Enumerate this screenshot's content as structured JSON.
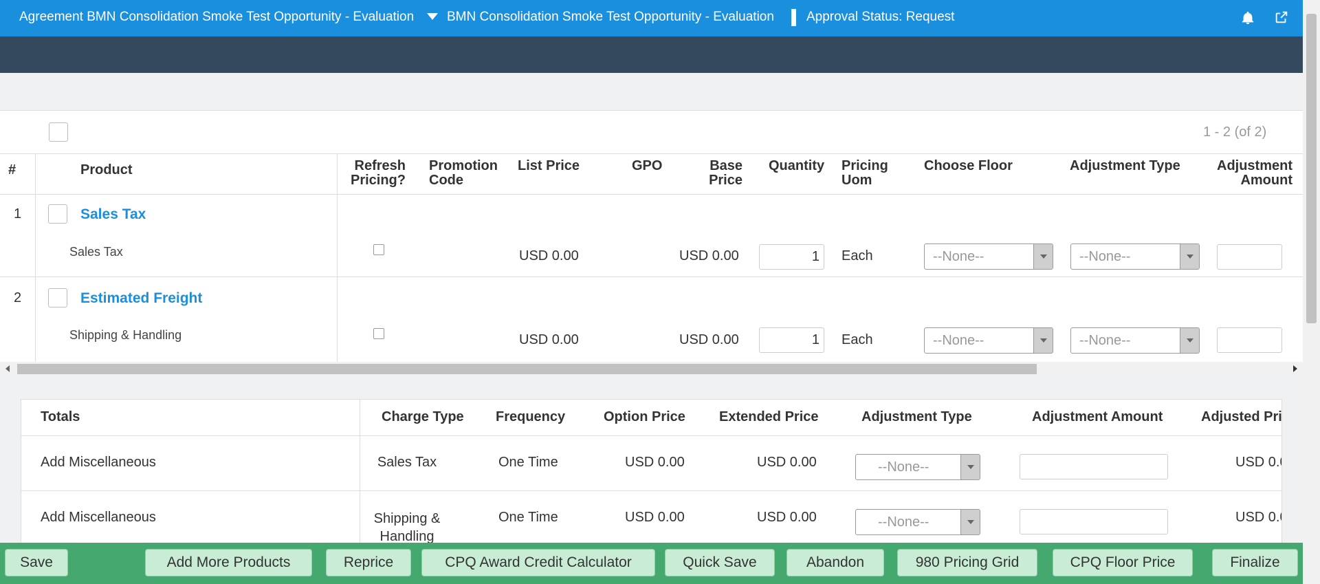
{
  "header": {
    "agreement_title": "Agreement BMN Consolidation Smoke Test Opportunity - Evaluation",
    "opportunity_title": "BMN Consolidation Smoke Test Opportunity - Evaluation",
    "approval_status": "Approval Status: Request"
  },
  "products": {
    "pager": "1 - 2 (of 2)",
    "columns": {
      "num": "#",
      "product": "Product",
      "refresh": "Refresh Pricing?",
      "promo": "Promotion Code",
      "list_price": "List Price",
      "gpo": "GPO",
      "base_price": "Base Price",
      "quantity": "Quantity",
      "uom": "Pricing Uom",
      "floor": "Choose Floor",
      "adj_type": "Adjustment Type",
      "adj_amount": "Adjustment Amount"
    },
    "rows": [
      {
        "num": "1",
        "name": "Sales Tax",
        "sub": "Sales Tax",
        "list_price": "USD 0.00",
        "base_price": "USD 0.00",
        "quantity": "1",
        "uom": "Each",
        "floor": "--None--",
        "adj_type": "--None--",
        "adj_amount": ""
      },
      {
        "num": "2",
        "name": "Estimated Freight",
        "sub": "Shipping & Handling",
        "list_price": "USD 0.00",
        "base_price": "USD 0.00",
        "quantity": "1",
        "uom": "Each",
        "floor": "--None--",
        "adj_type": "--None--",
        "adj_amount": ""
      }
    ]
  },
  "totals": {
    "columns": {
      "totals": "Totals",
      "charge_type": "Charge Type",
      "frequency": "Frequency",
      "option_price": "Option Price",
      "extended_price": "Extended Price",
      "adj_type": "Adjustment Type",
      "adj_amount": "Adjustment Amount",
      "adjusted_price": "Adjusted Pri"
    },
    "rows": [
      {
        "label": "Add Miscellaneous",
        "charge_type": "Sales Tax",
        "frequency": "One Time",
        "option_price": "USD 0.00",
        "extended_price": "USD 0.00",
        "adj_type": "--None--",
        "adj_amount": "",
        "adjusted_price": "USD 0.0"
      },
      {
        "label": "Add Miscellaneous",
        "charge_type": "Shipping & Handling",
        "frequency": "One Time",
        "option_price": "USD 0.00",
        "extended_price": "USD 0.00",
        "adj_type": "--None--",
        "adj_amount": "",
        "adjusted_price": "USD 0.0"
      }
    ]
  },
  "footer": {
    "buttons": [
      "Save",
      "Add More Products",
      "Reprice",
      "CPQ Award Credit Calculator",
      "Quick Save",
      "Abandon",
      "980 Pricing Grid",
      "CPQ Floor Price",
      "Finalize"
    ]
  },
  "colors": {
    "header_blue": "#1a8fdd",
    "nav_dark": "#34495e",
    "footer_green": "#45a86e",
    "button_green": "#c9ecd5",
    "link_blue": "#1a8fdd"
  },
  "icons": [
    "caret-down-icon",
    "bell-icon",
    "external-link-icon"
  ]
}
